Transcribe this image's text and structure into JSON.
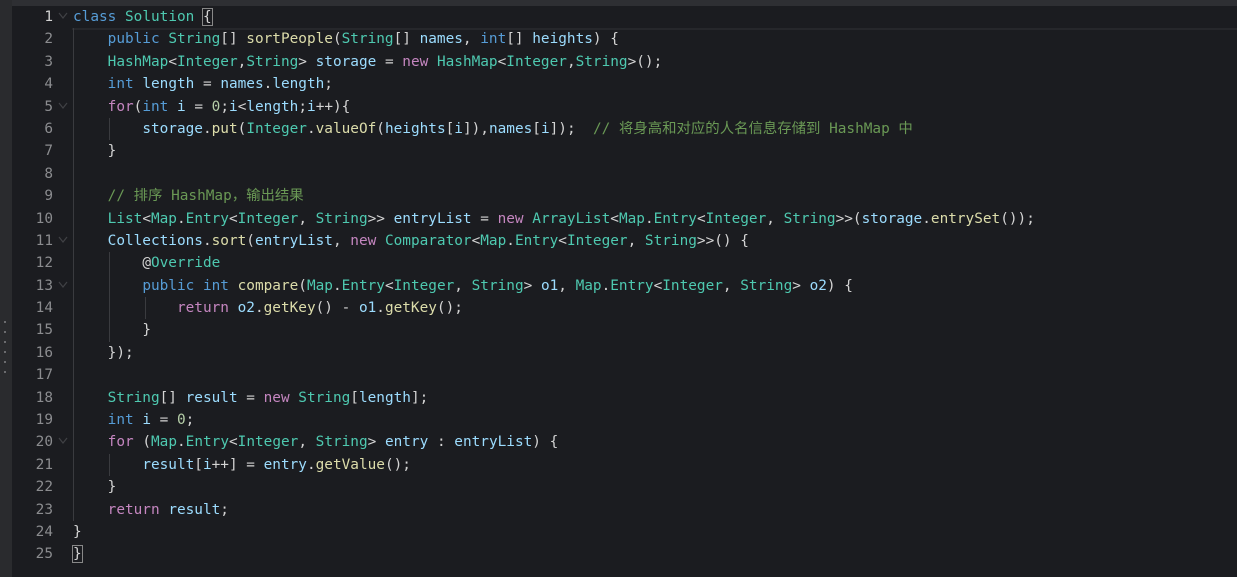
{
  "editor": {
    "language": "java",
    "active_line": 1,
    "lines": [
      {
        "n": "1",
        "indent": 0,
        "fold": true,
        "tokens": [
          [
            "kw",
            "class"
          ],
          [
            "plain",
            " "
          ],
          [
            "type",
            "Solution"
          ],
          [
            "plain",
            " "
          ],
          [
            "punc",
            "{",
            "match"
          ]
        ]
      },
      {
        "n": "2",
        "indent": 1,
        "fold": false,
        "tokens": [
          [
            "kw",
            "public"
          ],
          [
            "plain",
            " "
          ],
          [
            "type",
            "String"
          ],
          [
            "punc",
            "[] "
          ],
          [
            "fn",
            "sortPeople"
          ],
          [
            "punc",
            "("
          ],
          [
            "type",
            "String"
          ],
          [
            "punc",
            "[] "
          ],
          [
            "id",
            "names"
          ],
          [
            "punc",
            ", "
          ],
          [
            "kw",
            "int"
          ],
          [
            "punc",
            "[] "
          ],
          [
            "id",
            "heights"
          ],
          [
            "punc",
            ") {"
          ]
        ]
      },
      {
        "n": "3",
        "indent": 1,
        "fold": false,
        "tokens": [
          [
            "type",
            "HashMap"
          ],
          [
            "punc",
            "<"
          ],
          [
            "type",
            "Integer"
          ],
          [
            "punc",
            ","
          ],
          [
            "type",
            "String"
          ],
          [
            "punc",
            "> "
          ],
          [
            "id",
            "storage"
          ],
          [
            "punc",
            " = "
          ],
          [
            "kw2",
            "new"
          ],
          [
            "plain",
            " "
          ],
          [
            "type",
            "HashMap"
          ],
          [
            "punc",
            "<"
          ],
          [
            "type",
            "Integer"
          ],
          [
            "punc",
            ","
          ],
          [
            "type",
            "String"
          ],
          [
            "punc",
            ">();"
          ]
        ]
      },
      {
        "n": "4",
        "indent": 1,
        "fold": false,
        "tokens": [
          [
            "kw",
            "int"
          ],
          [
            "plain",
            " "
          ],
          [
            "id",
            "length"
          ],
          [
            "punc",
            " = "
          ],
          [
            "id",
            "names"
          ],
          [
            "punc",
            "."
          ],
          [
            "id",
            "length"
          ],
          [
            "punc",
            ";"
          ]
        ]
      },
      {
        "n": "5",
        "indent": 1,
        "fold": true,
        "tokens": [
          [
            "kw2",
            "for"
          ],
          [
            "punc",
            "("
          ],
          [
            "kw",
            "int"
          ],
          [
            "plain",
            " "
          ],
          [
            "id",
            "i"
          ],
          [
            "punc",
            " = "
          ],
          [
            "num",
            "0"
          ],
          [
            "punc",
            ";"
          ],
          [
            "id",
            "i"
          ],
          [
            "punc",
            "<"
          ],
          [
            "id",
            "length"
          ],
          [
            "punc",
            ";"
          ],
          [
            "id",
            "i"
          ],
          [
            "punc",
            "++){"
          ]
        ]
      },
      {
        "n": "6",
        "indent": 2,
        "fold": false,
        "tokens": [
          [
            "id",
            "storage"
          ],
          [
            "punc",
            "."
          ],
          [
            "fn",
            "put"
          ],
          [
            "punc",
            "("
          ],
          [
            "type",
            "Integer"
          ],
          [
            "punc",
            "."
          ],
          [
            "fn",
            "valueOf"
          ],
          [
            "punc",
            "("
          ],
          [
            "id",
            "heights"
          ],
          [
            "punc",
            "["
          ],
          [
            "id",
            "i"
          ],
          [
            "punc",
            "]),"
          ],
          [
            "id",
            "names"
          ],
          [
            "punc",
            "["
          ],
          [
            "id",
            "i"
          ],
          [
            "punc",
            "]);"
          ],
          [
            "plain",
            "  "
          ],
          [
            "cm",
            "// 将身高和对应的人名信息存储到 HashMap 中"
          ]
        ]
      },
      {
        "n": "7",
        "indent": 1,
        "fold": false,
        "tokens": [
          [
            "punc",
            "}"
          ]
        ]
      },
      {
        "n": "8",
        "indent": 1,
        "fold": false,
        "tokens": []
      },
      {
        "n": "9",
        "indent": 1,
        "fold": false,
        "tokens": [
          [
            "cm",
            "// 排序 HashMap，输出结果"
          ]
        ]
      },
      {
        "n": "10",
        "indent": 1,
        "fold": false,
        "tokens": [
          [
            "type",
            "List"
          ],
          [
            "punc",
            "<"
          ],
          [
            "type",
            "Map"
          ],
          [
            "punc",
            "."
          ],
          [
            "type",
            "Entry"
          ],
          [
            "punc",
            "<"
          ],
          [
            "type",
            "Integer"
          ],
          [
            "punc",
            ", "
          ],
          [
            "type",
            "String"
          ],
          [
            "punc",
            ">> "
          ],
          [
            "id",
            "entryList"
          ],
          [
            "punc",
            " = "
          ],
          [
            "kw2",
            "new"
          ],
          [
            "plain",
            " "
          ],
          [
            "type",
            "ArrayList"
          ],
          [
            "punc",
            "<"
          ],
          [
            "type",
            "Map"
          ],
          [
            "punc",
            "."
          ],
          [
            "type",
            "Entry"
          ],
          [
            "punc",
            "<"
          ],
          [
            "type",
            "Integer"
          ],
          [
            "punc",
            ", "
          ],
          [
            "type",
            "String"
          ],
          [
            "punc",
            ">>("
          ],
          [
            "id",
            "storage"
          ],
          [
            "punc",
            "."
          ],
          [
            "fn",
            "entrySet"
          ],
          [
            "punc",
            "());"
          ]
        ]
      },
      {
        "n": "11",
        "indent": 1,
        "fold": true,
        "tokens": [
          [
            "id",
            "Collections"
          ],
          [
            "punc",
            "."
          ],
          [
            "fn",
            "sort"
          ],
          [
            "punc",
            "("
          ],
          [
            "id",
            "entryList"
          ],
          [
            "punc",
            ", "
          ],
          [
            "kw2",
            "new"
          ],
          [
            "plain",
            " "
          ],
          [
            "type",
            "Comparator"
          ],
          [
            "punc",
            "<"
          ],
          [
            "type",
            "Map"
          ],
          [
            "punc",
            "."
          ],
          [
            "type",
            "Entry"
          ],
          [
            "punc",
            "<"
          ],
          [
            "type",
            "Integer"
          ],
          [
            "punc",
            ", "
          ],
          [
            "type",
            "String"
          ],
          [
            "punc",
            ">>() {"
          ]
        ]
      },
      {
        "n": "12",
        "indent": 2,
        "fold": false,
        "tokens": [
          [
            "punc",
            "@"
          ],
          [
            "ann",
            "Override"
          ]
        ]
      },
      {
        "n": "13",
        "indent": 2,
        "fold": true,
        "tokens": [
          [
            "kw",
            "public"
          ],
          [
            "plain",
            " "
          ],
          [
            "kw",
            "int"
          ],
          [
            "plain",
            " "
          ],
          [
            "fn",
            "compare"
          ],
          [
            "punc",
            "("
          ],
          [
            "type",
            "Map"
          ],
          [
            "punc",
            "."
          ],
          [
            "type",
            "Entry"
          ],
          [
            "punc",
            "<"
          ],
          [
            "type",
            "Integer"
          ],
          [
            "punc",
            ", "
          ],
          [
            "type",
            "String"
          ],
          [
            "punc",
            "> "
          ],
          [
            "id",
            "o1"
          ],
          [
            "punc",
            ", "
          ],
          [
            "type",
            "Map"
          ],
          [
            "punc",
            "."
          ],
          [
            "type",
            "Entry"
          ],
          [
            "punc",
            "<"
          ],
          [
            "type",
            "Integer"
          ],
          [
            "punc",
            ", "
          ],
          [
            "type",
            "String"
          ],
          [
            "punc",
            "> "
          ],
          [
            "id",
            "o2"
          ],
          [
            "punc",
            ") {"
          ]
        ]
      },
      {
        "n": "14",
        "indent": 3,
        "fold": false,
        "tokens": [
          [
            "kw2",
            "return"
          ],
          [
            "plain",
            " "
          ],
          [
            "id",
            "o2"
          ],
          [
            "punc",
            "."
          ],
          [
            "fn",
            "getKey"
          ],
          [
            "punc",
            "() - "
          ],
          [
            "id",
            "o1"
          ],
          [
            "punc",
            "."
          ],
          [
            "fn",
            "getKey"
          ],
          [
            "punc",
            "();"
          ]
        ]
      },
      {
        "n": "15",
        "indent": 2,
        "fold": false,
        "tokens": [
          [
            "punc",
            "}"
          ]
        ]
      },
      {
        "n": "16",
        "indent": 1,
        "fold": false,
        "tokens": [
          [
            "punc",
            "});"
          ]
        ]
      },
      {
        "n": "17",
        "indent": 1,
        "fold": false,
        "tokens": []
      },
      {
        "n": "18",
        "indent": 1,
        "fold": false,
        "tokens": [
          [
            "type",
            "String"
          ],
          [
            "punc",
            "[] "
          ],
          [
            "id",
            "result"
          ],
          [
            "punc",
            " = "
          ],
          [
            "kw2",
            "new"
          ],
          [
            "plain",
            " "
          ],
          [
            "type",
            "String"
          ],
          [
            "punc",
            "["
          ],
          [
            "id",
            "length"
          ],
          [
            "punc",
            "];"
          ]
        ]
      },
      {
        "n": "19",
        "indent": 1,
        "fold": false,
        "tokens": [
          [
            "kw",
            "int"
          ],
          [
            "plain",
            " "
          ],
          [
            "id",
            "i"
          ],
          [
            "punc",
            " = "
          ],
          [
            "num",
            "0"
          ],
          [
            "punc",
            ";"
          ]
        ]
      },
      {
        "n": "20",
        "indent": 1,
        "fold": true,
        "tokens": [
          [
            "kw2",
            "for"
          ],
          [
            "plain",
            " "
          ],
          [
            "punc",
            "("
          ],
          [
            "type",
            "Map"
          ],
          [
            "punc",
            "."
          ],
          [
            "type",
            "Entry"
          ],
          [
            "punc",
            "<"
          ],
          [
            "type",
            "Integer"
          ],
          [
            "punc",
            ", "
          ],
          [
            "type",
            "String"
          ],
          [
            "punc",
            "> "
          ],
          [
            "id",
            "entry"
          ],
          [
            "punc",
            " : "
          ],
          [
            "id",
            "entryList"
          ],
          [
            "punc",
            ") {"
          ]
        ]
      },
      {
        "n": "21",
        "indent": 2,
        "fold": false,
        "tokens": [
          [
            "id",
            "result"
          ],
          [
            "punc",
            "["
          ],
          [
            "id",
            "i"
          ],
          [
            "punc",
            "++] = "
          ],
          [
            "id",
            "entry"
          ],
          [
            "punc",
            "."
          ],
          [
            "fn",
            "getValue"
          ],
          [
            "punc",
            "();"
          ]
        ]
      },
      {
        "n": "22",
        "indent": 1,
        "fold": false,
        "tokens": [
          [
            "punc",
            "}"
          ]
        ]
      },
      {
        "n": "23",
        "indent": 1,
        "fold": false,
        "tokens": [
          [
            "kw2",
            "return"
          ],
          [
            "plain",
            " "
          ],
          [
            "id",
            "result"
          ],
          [
            "punc",
            ";"
          ]
        ]
      },
      {
        "n": "24",
        "indent": 0,
        "fold": false,
        "tokens": [
          [
            "punc",
            "}"
          ]
        ]
      },
      {
        "n": "25",
        "indent": 0,
        "fold": false,
        "tokens": [
          [
            "punc",
            "}",
            "match"
          ]
        ]
      }
    ]
  }
}
